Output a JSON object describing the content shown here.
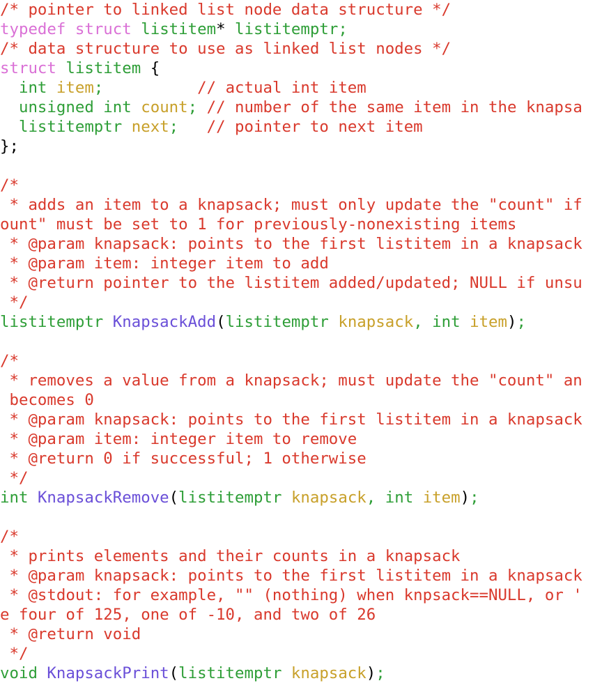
{
  "editor": {
    "language": "C",
    "background": "#ffffff",
    "wrap_enabled": true,
    "font_size_px": 22,
    "line_height_px": 28,
    "palette": {
      "plain": "#000000",
      "comment": "#d9392c",
      "keyword": "#da70d6",
      "type": "#2e9e37",
      "identifier": "#c8a02a",
      "function": "#6a4fd8",
      "punctuation": "#2e9e37",
      "operator": "#000000"
    }
  },
  "lines": [
    {
      "tokens": [
        {
          "t": "/* pointer to linked list node data structure */",
          "c": "comment"
        }
      ]
    },
    {
      "tokens": [
        {
          "t": "typedef",
          "c": "keyword"
        },
        {
          "t": " ",
          "c": "plain"
        },
        {
          "t": "struct",
          "c": "keyword"
        },
        {
          "t": " ",
          "c": "plain"
        },
        {
          "t": "listitem",
          "c": "type"
        },
        {
          "t": "*",
          "c": "op"
        },
        {
          "t": " ",
          "c": "plain"
        },
        {
          "t": "listitemptr;",
          "c": "type"
        }
      ]
    },
    {
      "tokens": [
        {
          "t": "/* data structure to use as linked list nodes */",
          "c": "comment"
        }
      ]
    },
    {
      "tokens": [
        {
          "t": "struct",
          "c": "keyword"
        },
        {
          "t": " ",
          "c": "plain"
        },
        {
          "t": "listitem",
          "c": "type"
        },
        {
          "t": " ",
          "c": "plain"
        },
        {
          "t": "{",
          "c": "plain"
        }
      ]
    },
    {
      "tokens": [
        {
          "t": "  ",
          "c": "plain"
        },
        {
          "t": "int",
          "c": "type"
        },
        {
          "t": " ",
          "c": "plain"
        },
        {
          "t": "item",
          "c": "ident"
        },
        {
          "t": ";",
          "c": "punct"
        },
        {
          "t": "          ",
          "c": "plain"
        },
        {
          "t": "// actual int item",
          "c": "comment"
        }
      ]
    },
    {
      "tokens": [
        {
          "t": "  ",
          "c": "plain"
        },
        {
          "t": "unsigned",
          "c": "type"
        },
        {
          "t": " ",
          "c": "plain"
        },
        {
          "t": "int",
          "c": "type"
        },
        {
          "t": " ",
          "c": "plain"
        },
        {
          "t": "count",
          "c": "ident"
        },
        {
          "t": ";",
          "c": "punct"
        },
        {
          "t": " ",
          "c": "plain"
        },
        {
          "t": "// number of the same item in the knapsa",
          "c": "comment"
        }
      ]
    },
    {
      "tokens": [
        {
          "t": "  ",
          "c": "plain"
        },
        {
          "t": "listitemptr",
          "c": "type"
        },
        {
          "t": " ",
          "c": "plain"
        },
        {
          "t": "next",
          "c": "ident"
        },
        {
          "t": ";",
          "c": "punct"
        },
        {
          "t": "   ",
          "c": "plain"
        },
        {
          "t": "// pointer to next item",
          "c": "comment"
        }
      ]
    },
    {
      "tokens": [
        {
          "t": "};",
          "c": "plain"
        }
      ]
    },
    {
      "tokens": [],
      "blank": true
    },
    {
      "tokens": [
        {
          "t": "/*",
          "c": "comment"
        }
      ]
    },
    {
      "tokens": [
        {
          "t": " * adds an item to a knapsack; must only update the \"count\" if",
          "c": "comment"
        }
      ]
    },
    {
      "tokens": [
        {
          "t": "ount\" must be set to 1 for previously-nonexisting items",
          "c": "comment"
        }
      ]
    },
    {
      "tokens": [
        {
          "t": " * @param knapsack: points to the first listitem in a knapsack",
          "c": "comment"
        }
      ]
    },
    {
      "tokens": [
        {
          "t": " * @param item: integer item to add",
          "c": "comment"
        }
      ]
    },
    {
      "tokens": [
        {
          "t": " * @return pointer to the listitem added/updated; NULL if unsu",
          "c": "comment"
        }
      ]
    },
    {
      "tokens": [
        {
          "t": " */",
          "c": "comment"
        }
      ]
    },
    {
      "tokens": [
        {
          "t": "listitemptr",
          "c": "type"
        },
        {
          "t": " ",
          "c": "plain"
        },
        {
          "t": "KnapsackAdd",
          "c": "func"
        },
        {
          "t": "(",
          "c": "plain"
        },
        {
          "t": "listitemptr",
          "c": "type"
        },
        {
          "t": " ",
          "c": "plain"
        },
        {
          "t": "knapsack",
          "c": "ident"
        },
        {
          "t": ",",
          "c": "punct"
        },
        {
          "t": " ",
          "c": "plain"
        },
        {
          "t": "int",
          "c": "type"
        },
        {
          "t": " ",
          "c": "plain"
        },
        {
          "t": "item",
          "c": "ident"
        },
        {
          "t": ")",
          "c": "plain"
        },
        {
          "t": ";",
          "c": "punct"
        }
      ]
    },
    {
      "tokens": [],
      "blank": true
    },
    {
      "tokens": [
        {
          "t": "/*",
          "c": "comment"
        }
      ]
    },
    {
      "tokens": [
        {
          "t": " * removes a value from a knapsack; must update the \"count\" an",
          "c": "comment"
        }
      ]
    },
    {
      "tokens": [
        {
          "t": " becomes 0",
          "c": "comment"
        }
      ]
    },
    {
      "tokens": [
        {
          "t": " * @param knapsack: points to the first listitem in a knapsack",
          "c": "comment"
        }
      ]
    },
    {
      "tokens": [
        {
          "t": " * @param item: integer item to remove",
          "c": "comment"
        }
      ]
    },
    {
      "tokens": [
        {
          "t": " * @return 0 if successful; 1 otherwise",
          "c": "comment"
        }
      ]
    },
    {
      "tokens": [
        {
          "t": " */",
          "c": "comment"
        }
      ]
    },
    {
      "tokens": [
        {
          "t": "int",
          "c": "type"
        },
        {
          "t": " ",
          "c": "plain"
        },
        {
          "t": "KnapsackRemove",
          "c": "func"
        },
        {
          "t": "(",
          "c": "plain"
        },
        {
          "t": "listitemptr",
          "c": "type"
        },
        {
          "t": " ",
          "c": "plain"
        },
        {
          "t": "knapsack",
          "c": "ident"
        },
        {
          "t": ",",
          "c": "punct"
        },
        {
          "t": " ",
          "c": "plain"
        },
        {
          "t": "int",
          "c": "type"
        },
        {
          "t": " ",
          "c": "plain"
        },
        {
          "t": "item",
          "c": "ident"
        },
        {
          "t": ")",
          "c": "plain"
        },
        {
          "t": ";",
          "c": "punct"
        }
      ]
    },
    {
      "tokens": [],
      "blank": true
    },
    {
      "tokens": [
        {
          "t": "/*",
          "c": "comment"
        }
      ]
    },
    {
      "tokens": [
        {
          "t": " * prints elements and their counts in a knapsack",
          "c": "comment"
        }
      ]
    },
    {
      "tokens": [
        {
          "t": " * @param knapsack: points to the first listitem in a knapsack",
          "c": "comment"
        }
      ]
    },
    {
      "tokens": [
        {
          "t": " * @stdout: for example, \"\" (nothing) when knpsack==NULL, or '",
          "c": "comment"
        }
      ]
    },
    {
      "tokens": [
        {
          "t": "e four of 125, one of -10, and two of 26",
          "c": "comment"
        }
      ]
    },
    {
      "tokens": [
        {
          "t": " * @return void",
          "c": "comment"
        }
      ]
    },
    {
      "tokens": [
        {
          "t": " */",
          "c": "comment"
        }
      ]
    },
    {
      "tokens": [
        {
          "t": "void",
          "c": "type"
        },
        {
          "t": " ",
          "c": "plain"
        },
        {
          "t": "KnapsackPrint",
          "c": "func"
        },
        {
          "t": "(",
          "c": "plain"
        },
        {
          "t": "listitemptr",
          "c": "type"
        },
        {
          "t": " ",
          "c": "plain"
        },
        {
          "t": "knapsack",
          "c": "ident"
        },
        {
          "t": ")",
          "c": "plain"
        },
        {
          "t": ";",
          "c": "punct"
        }
      ]
    }
  ]
}
